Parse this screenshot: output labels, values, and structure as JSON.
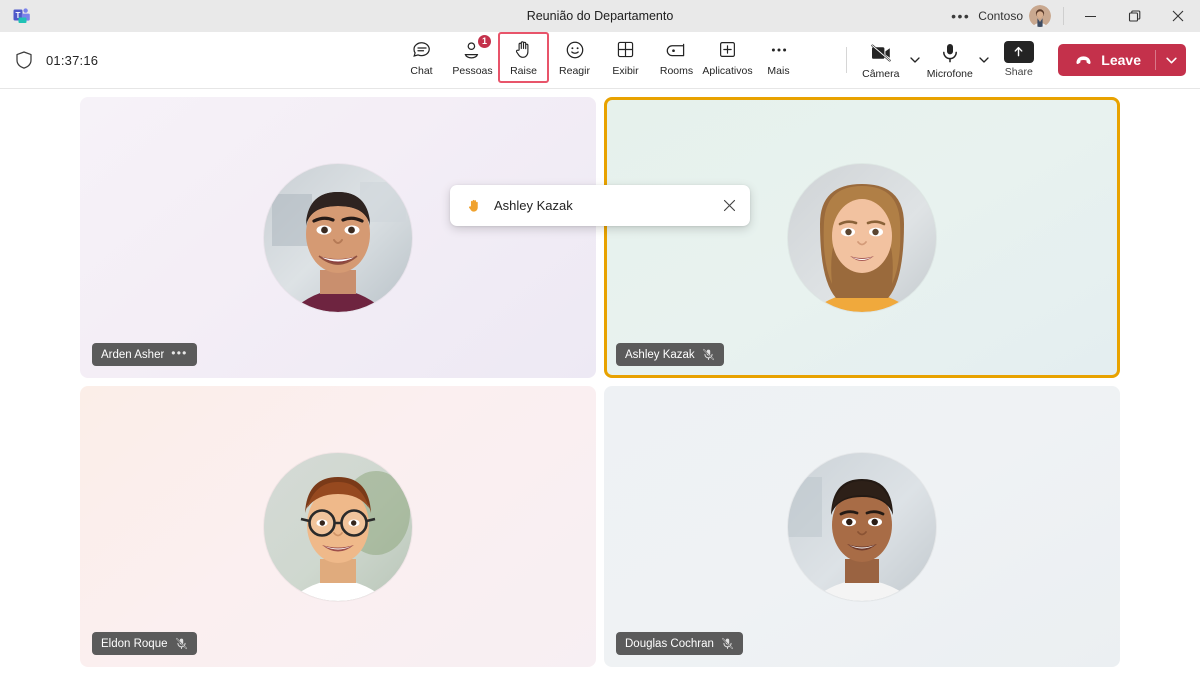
{
  "titlebar": {
    "logo_icon": "teams-logo-icon",
    "title": "Reunião do Departamento",
    "overflow_label": "•••",
    "org": "Contoso",
    "avatar_icon": "user-avatar",
    "minimize_label": "Minimize",
    "maximize_label": "Restore",
    "close_label": "Close"
  },
  "toolbar": {
    "shield_icon": "shield-icon",
    "timer": "01:37:16",
    "buttons": [
      {
        "label": "Chat",
        "icon": "chat-icon",
        "badge": null,
        "highlight": false
      },
      {
        "label": "Pessoas",
        "icon": "people-icon",
        "badge": "1",
        "highlight": false
      },
      {
        "label": "Raise",
        "icon": "raise-hand-icon",
        "badge": null,
        "highlight": true
      },
      {
        "label": "Reagir",
        "icon": "emoji-icon",
        "badge": null,
        "highlight": false
      },
      {
        "label": "Exibir",
        "icon": "view-grid-icon",
        "badge": null,
        "highlight": false
      },
      {
        "label": "Rooms",
        "icon": "rooms-icon",
        "badge": null,
        "highlight": false
      },
      {
        "label": "Aplicativos",
        "icon": "apps-plus-icon",
        "badge": null,
        "highlight": false
      },
      {
        "label": "Mais",
        "icon": "more-dots-icon",
        "badge": null,
        "highlight": false
      }
    ],
    "camera": {
      "label": "Câmera",
      "icon": "camera-off-icon",
      "state": "off",
      "chevron_icon": "chevron-down-icon"
    },
    "microphone": {
      "label": "Microfone",
      "icon": "microphone-icon",
      "state": "on",
      "chevron_icon": "chevron-down-icon"
    },
    "share": {
      "label": "Share",
      "icon": "share-up-arrow-icon"
    },
    "leave": {
      "label": "Leave",
      "icon": "hangup-phone-icon",
      "chevron_icon": "chevron-down-icon",
      "color": "#c4314b"
    }
  },
  "toast": {
    "hand_icon": "raised-hand-emoji",
    "name": "Ashley Kazak",
    "close_icon": "close-icon"
  },
  "stage": {
    "highlight_color": "#e8a200",
    "tiles": [
      {
        "name": "Arden Asher",
        "muted": false,
        "has_overflow": true,
        "overflow_label": "•••",
        "mic_icon": null,
        "active": false,
        "avatar": "arden-asher-avatar"
      },
      {
        "name": "Ashley Kazak",
        "muted": true,
        "has_overflow": false,
        "overflow_label": "",
        "mic_icon": "mic-off-icon",
        "active": true,
        "avatar": "ashley-kazak-avatar"
      },
      {
        "name": "Eldon Roque",
        "muted": true,
        "has_overflow": false,
        "overflow_label": "",
        "mic_icon": "mic-off-icon",
        "active": false,
        "avatar": "eldon-roque-avatar"
      },
      {
        "name": "Douglas Cochran",
        "muted": true,
        "has_overflow": false,
        "overflow_label": "",
        "mic_icon": "mic-off-icon",
        "active": false,
        "avatar": "douglas-cochran-avatar"
      }
    ]
  }
}
